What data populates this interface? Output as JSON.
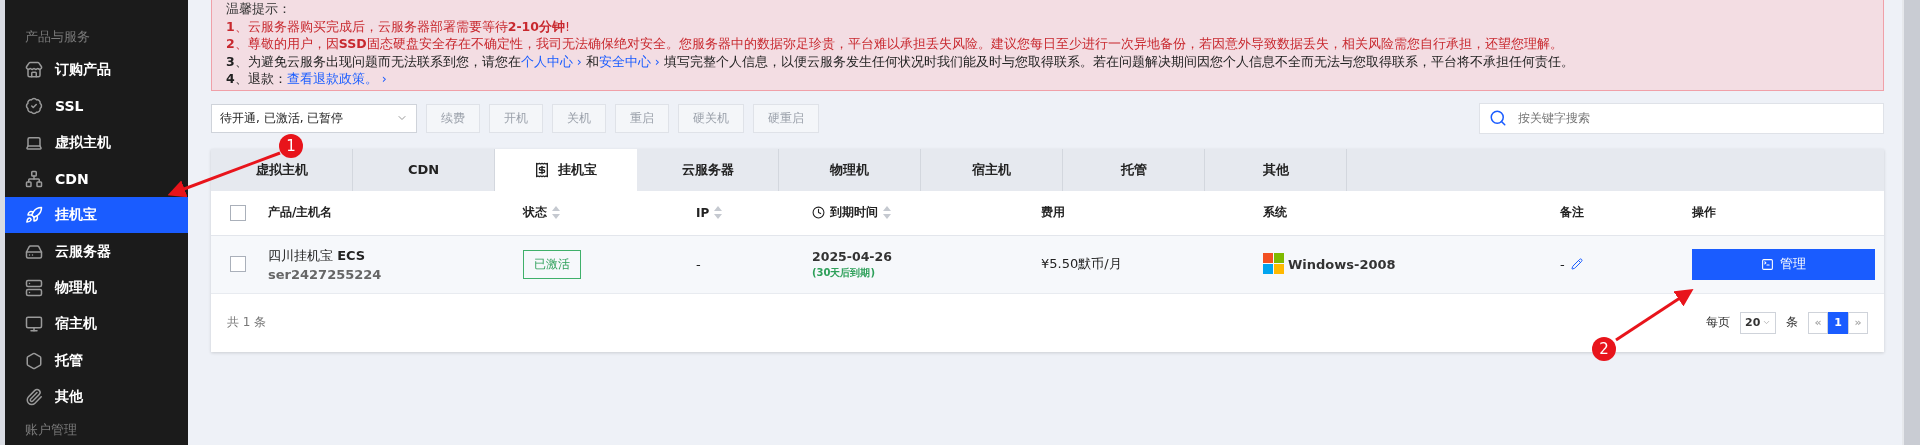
{
  "sidebar": {
    "heading": "产品与服务",
    "items": [
      {
        "label": "订购产品",
        "selected": false
      },
      {
        "label": "SSL",
        "selected": false
      },
      {
        "label": "虚拟主机",
        "selected": false
      },
      {
        "label": "CDN",
        "selected": false
      },
      {
        "label": "挂机宝",
        "selected": true
      },
      {
        "label": "云服务器",
        "selected": false
      },
      {
        "label": "物理机",
        "selected": false
      },
      {
        "label": "宿主机",
        "selected": false
      },
      {
        "label": "托管",
        "selected": false
      },
      {
        "label": "其他",
        "selected": false
      }
    ],
    "next_heading": "账户管理"
  },
  "notice": {
    "title": "温馨提示：",
    "lines": [
      {
        "kind": "warning",
        "parts": [
          {
            "kind": "text",
            "text": "**1**、云服务器购买完成后，云服务器部署需要等待**2-10分钟**!"
          }
        ]
      },
      {
        "kind": "warning",
        "parts": [
          {
            "kind": "text",
            "text": "**2**、尊敬的用户，因**SSD**固态硬盘安全存在不确定性，我司无法确保绝对安全。您服务器中的数据弥足珍贵，平台难以承担丢失风险。建议您每日至少进行一次异地备份，若因意外导致数据丢失，相关风险需您自行承担，还望您理解。"
          }
        ]
      },
      {
        "kind": "normal",
        "parts": [
          {
            "kind": "text",
            "text": "**3**、为避免云服务出现问题而无法联系到您，请您在"
          },
          {
            "kind": "link",
            "text": "个人中心 ›"
          },
          {
            "kind": "text",
            "text": " 和"
          },
          {
            "kind": "link",
            "text": "安全中心 ›"
          },
          {
            "kind": "text",
            "text": " 填写完整个人信息，以便云服务发生任何状况时我们能及时与您取得联系。若在问题解决期间因您个人信息不全而无法与您取得联系，平台将不承担任何责任。"
          }
        ]
      },
      {
        "kind": "normal",
        "parts": [
          {
            "kind": "text",
            "text": "**4**、退款："
          },
          {
            "kind": "link",
            "text": "查看退款政策。 ›"
          }
        ]
      }
    ]
  },
  "toolbar": {
    "filter": {
      "value": "待开通, 已激活, 已暂停"
    },
    "buttons": [
      {
        "label": "续费",
        "disabled": true
      },
      {
        "label": "开机",
        "disabled": true
      },
      {
        "label": "关机",
        "disabled": true
      },
      {
        "label": "重启",
        "disabled": true
      },
      {
        "label": "硬关机",
        "disabled": true
      },
      {
        "label": "硬重启",
        "disabled": true
      }
    ],
    "search": {
      "placeholder": "按关键字搜索"
    }
  },
  "tabs": [
    {
      "label": "虚拟主机",
      "selected": false
    },
    {
      "label": "CDN",
      "selected": false
    },
    {
      "label": "挂机宝",
      "selected": true
    },
    {
      "label": "云服务器",
      "selected": false
    },
    {
      "label": "物理机",
      "selected": false
    },
    {
      "label": "宿主机",
      "selected": false
    },
    {
      "label": "托管",
      "selected": false
    },
    {
      "label": "其他",
      "selected": false
    }
  ],
  "table": {
    "header_checked": false,
    "columns": [
      {
        "label": "产品/主机名",
        "sortable": false,
        "kind": "plain"
      },
      {
        "label": "状态",
        "sortable": true,
        "kind": "plain"
      },
      {
        "label": "IP",
        "sortable": true,
        "kind": "plain"
      },
      {
        "label": "到期时间",
        "sortable": true,
        "kind": "date"
      },
      {
        "label": "费用",
        "sortable": false,
        "kind": "plain"
      },
      {
        "label": "系统",
        "sortable": false,
        "kind": "plain"
      },
      {
        "label": "备注",
        "sortable": false,
        "kind": "plain"
      },
      {
        "label": "操作",
        "sortable": false,
        "kind": "plain"
      }
    ],
    "rows": [
      {
        "checked": false,
        "name": "四川挂机宝 **ECS**",
        "host": "ser2427255224",
        "status": "已激活",
        "ip": "-",
        "expiry": "2025-04-26",
        "remaining": "(30天后到期)",
        "price": "¥5.50默币/月",
        "os": "Windows-2008",
        "remark": "-",
        "action": "管理"
      }
    ]
  },
  "footer": {
    "total": "共 1 条",
    "per_page_label": "每页",
    "per_page": "20",
    "unit": "条",
    "pages": [
      {
        "label": "«",
        "selected": false
      },
      {
        "label": "1",
        "selected": true
      },
      {
        "label": "»",
        "selected": false
      }
    ]
  },
  "annotations": [
    {
      "label": "1"
    },
    {
      "label": "2"
    }
  ]
}
